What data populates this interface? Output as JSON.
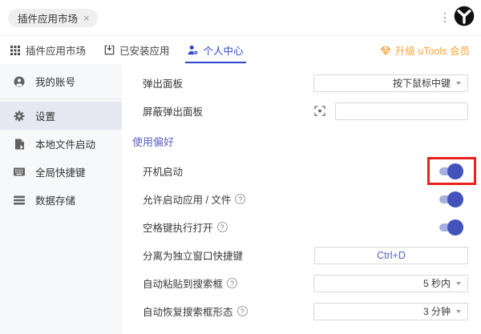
{
  "window": {
    "tab": {
      "label": "插件应用市场",
      "close_symbol": "×"
    }
  },
  "nav": {
    "tabs": [
      {
        "label": "插件应用市场",
        "icon": "grid-icon",
        "active": false
      },
      {
        "label": "已安装应用",
        "icon": "download-box-icon",
        "active": false
      },
      {
        "label": "个人中心",
        "icon": "person-gear-icon",
        "active": true
      }
    ],
    "upgrade_label": "升级 uTools 会员"
  },
  "sidebar": {
    "items": [
      {
        "label": "我的账号",
        "icon": "account-icon",
        "selected": false
      },
      {
        "label": "设置",
        "icon": "gear-icon",
        "selected": true
      },
      {
        "label": "本地文件启动",
        "icon": "file-launch-icon",
        "selected": false
      },
      {
        "label": "全局快捷键",
        "icon": "keyboard-icon",
        "selected": false
      },
      {
        "label": "数据存储",
        "icon": "storage-icon",
        "selected": false
      }
    ]
  },
  "settings": {
    "help_symbol": "?",
    "popup_panel": {
      "label": "弹出面板",
      "value": "按下鼠标中键"
    },
    "block_popup": {
      "label": "屏蔽弹出面板",
      "value": ""
    },
    "section_title": "使用偏好",
    "auto_start": {
      "label": "开机启动",
      "on": true,
      "annotated": true
    },
    "allow_launch": {
      "label": "允许启动应用 / 文件",
      "on": true
    },
    "space_open": {
      "label": "空格键执行打开",
      "on": true
    },
    "detach_hotkey": {
      "label": "分离为独立窗口快捷键",
      "value": "Ctrl+D"
    },
    "auto_paste": {
      "label": "自动粘贴到搜索框",
      "value": "5 秒内"
    },
    "auto_restore": {
      "label": "自动恢复搜索框形态",
      "value": "3 分钟"
    }
  },
  "colors": {
    "accent_blue": "#2e46c9",
    "section_indigo": "#5b60c1",
    "toggle_track": "#a6afdd",
    "toggle_knob": "#4353bb",
    "upgrade_orange": "#f9a43c",
    "annotation_red": "#e8211d",
    "sidebar_selected_bg": "#e6e8f1",
    "hotkey_text": "#5560c5"
  }
}
